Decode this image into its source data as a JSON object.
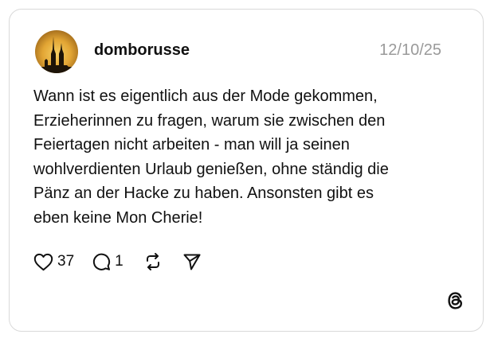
{
  "post": {
    "username": "domborusse",
    "date": "12/10/25",
    "text_lines": [
      "Wann ist es eigentlich aus der Mode gekommen,",
      "Erzieherinnen zu fragen, warum sie zwischen den",
      "Feiertagen nicht arbeiten - man will ja seinen",
      "wohlverdienten Urlaub genießen, ohne ständig die",
      "Pänz an der Hacke zu haben. Ansonsten gibt es",
      "eben keine Mon Cherie!"
    ],
    "likes": "37",
    "replies": "1"
  },
  "icons": {
    "avatar": "cathedral-silhouette-at-sunset",
    "like": "heart-icon",
    "reply": "speech-bubble-icon",
    "repost": "repost-icon",
    "share": "paper-plane-icon",
    "logo": "threads-logo"
  },
  "colors": {
    "text": "#111111",
    "date": "#9a9a9a",
    "border": "#d9d9d9",
    "avatar_sky": "#e2a534"
  }
}
